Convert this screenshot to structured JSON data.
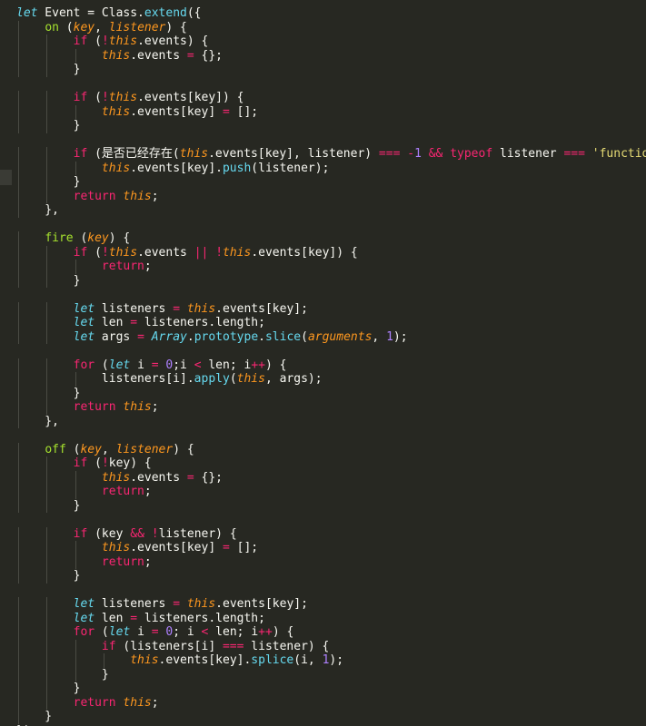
{
  "theme": {
    "background": "#272822",
    "plain": "#f8f8f2",
    "storage": "#66d9ef",
    "keyword": "#f92672",
    "function": "#a6e22e",
    "param": "#fd971f",
    "number": "#ae81ff",
    "string": "#e6db74"
  },
  "code_lines": [
    [
      [
        "storage",
        "let"
      ],
      [
        "plain",
        " Event = Class."
      ],
      [
        "support",
        "extend"
      ],
      [
        "plain",
        "({"
      ]
    ],
    [
      [
        "plain",
        "    "
      ],
      [
        "function",
        "on"
      ],
      [
        "plain",
        " ("
      ],
      [
        "param",
        "key"
      ],
      [
        "plain",
        ", "
      ],
      [
        "param",
        "listener"
      ],
      [
        "plain",
        ") {"
      ]
    ],
    [
      [
        "plain",
        "        "
      ],
      [
        "keyword",
        "if"
      ],
      [
        "plain",
        " ("
      ],
      [
        "operator",
        "!"
      ],
      [
        "this",
        "this"
      ],
      [
        "plain",
        ".events) {"
      ]
    ],
    [
      [
        "plain",
        "            "
      ],
      [
        "this",
        "this"
      ],
      [
        "plain",
        ".events "
      ],
      [
        "operator",
        "="
      ],
      [
        "plain",
        " {};"
      ]
    ],
    [
      [
        "plain",
        "        }"
      ]
    ],
    [],
    [
      [
        "plain",
        "        "
      ],
      [
        "keyword",
        "if"
      ],
      [
        "plain",
        " ("
      ],
      [
        "operator",
        "!"
      ],
      [
        "this",
        "this"
      ],
      [
        "plain",
        ".events[key]) {"
      ]
    ],
    [
      [
        "plain",
        "            "
      ],
      [
        "this",
        "this"
      ],
      [
        "plain",
        ".events[key] "
      ],
      [
        "operator",
        "="
      ],
      [
        "plain",
        " [];"
      ]
    ],
    [
      [
        "plain",
        "        }"
      ]
    ],
    [],
    [
      [
        "plain",
        "        "
      ],
      [
        "keyword",
        "if"
      ],
      [
        "plain",
        " (是否已经存在("
      ],
      [
        "this",
        "this"
      ],
      [
        "plain",
        ".events[key], listener) "
      ],
      [
        "operator",
        "==="
      ],
      [
        "plain",
        " "
      ],
      [
        "operator",
        "-"
      ],
      [
        "number",
        "1"
      ],
      [
        "plain",
        " "
      ],
      [
        "operator",
        "&&"
      ],
      [
        "plain",
        " "
      ],
      [
        "keyword",
        "typeof"
      ],
      [
        "plain",
        " listener "
      ],
      [
        "operator",
        "==="
      ],
      [
        "plain",
        " "
      ],
      [
        "string",
        "'function'"
      ],
      [
        "plain",
        ") "
      ],
      [
        "cursor",
        "{"
      ]
    ],
    [
      [
        "plain",
        "            "
      ],
      [
        "this",
        "this"
      ],
      [
        "plain",
        ".events[key]."
      ],
      [
        "support",
        "push"
      ],
      [
        "plain",
        "(listener);"
      ]
    ],
    [
      [
        "plain",
        "        }"
      ]
    ],
    [
      [
        "plain",
        "        "
      ],
      [
        "keyword",
        "return"
      ],
      [
        "plain",
        " "
      ],
      [
        "this",
        "this"
      ],
      [
        "plain",
        ";"
      ]
    ],
    [
      [
        "plain",
        "    },"
      ]
    ],
    [],
    [
      [
        "plain",
        "    "
      ],
      [
        "function",
        "fire"
      ],
      [
        "plain",
        " ("
      ],
      [
        "param",
        "key"
      ],
      [
        "plain",
        ") {"
      ]
    ],
    [
      [
        "plain",
        "        "
      ],
      [
        "keyword",
        "if"
      ],
      [
        "plain",
        " ("
      ],
      [
        "operator",
        "!"
      ],
      [
        "this",
        "this"
      ],
      [
        "plain",
        ".events "
      ],
      [
        "operator",
        "||"
      ],
      [
        "plain",
        " "
      ],
      [
        "operator",
        "!"
      ],
      [
        "this",
        "this"
      ],
      [
        "plain",
        ".events[key]) {"
      ]
    ],
    [
      [
        "plain",
        "            "
      ],
      [
        "keyword",
        "return"
      ],
      [
        "plain",
        ";"
      ]
    ],
    [
      [
        "plain",
        "        }"
      ]
    ],
    [],
    [
      [
        "plain",
        "        "
      ],
      [
        "storage",
        "let"
      ],
      [
        "plain",
        " listeners "
      ],
      [
        "operator",
        "="
      ],
      [
        "plain",
        " "
      ],
      [
        "this",
        "this"
      ],
      [
        "plain",
        ".events[key];"
      ]
    ],
    [
      [
        "plain",
        "        "
      ],
      [
        "storage",
        "let"
      ],
      [
        "plain",
        " len "
      ],
      [
        "operator",
        "="
      ],
      [
        "plain",
        " listeners.length;"
      ]
    ],
    [
      [
        "plain",
        "        "
      ],
      [
        "storage",
        "let"
      ],
      [
        "plain",
        " args "
      ],
      [
        "operator",
        "="
      ],
      [
        "plain",
        " "
      ],
      [
        "builtin",
        "Array"
      ],
      [
        "plain",
        "."
      ],
      [
        "support",
        "prototype"
      ],
      [
        "plain",
        "."
      ],
      [
        "support",
        "slice"
      ],
      [
        "plain",
        "("
      ],
      [
        "param",
        "arguments"
      ],
      [
        "plain",
        ", "
      ],
      [
        "number",
        "1"
      ],
      [
        "plain",
        ");"
      ]
    ],
    [],
    [
      [
        "plain",
        "        "
      ],
      [
        "keyword",
        "for"
      ],
      [
        "plain",
        " ("
      ],
      [
        "storage",
        "let"
      ],
      [
        "plain",
        " i "
      ],
      [
        "operator",
        "="
      ],
      [
        "plain",
        " "
      ],
      [
        "number",
        "0"
      ],
      [
        "plain",
        ";i "
      ],
      [
        "operator",
        "<"
      ],
      [
        "plain",
        " len; i"
      ],
      [
        "operator",
        "++"
      ],
      [
        "plain",
        ") {"
      ]
    ],
    [
      [
        "plain",
        "            listeners[i]."
      ],
      [
        "support",
        "apply"
      ],
      [
        "plain",
        "("
      ],
      [
        "this",
        "this"
      ],
      [
        "plain",
        ", args);"
      ]
    ],
    [
      [
        "plain",
        "        }"
      ]
    ],
    [
      [
        "plain",
        "        "
      ],
      [
        "keyword",
        "return"
      ],
      [
        "plain",
        " "
      ],
      [
        "this",
        "this"
      ],
      [
        "plain",
        ";"
      ]
    ],
    [
      [
        "plain",
        "    },"
      ]
    ],
    [],
    [
      [
        "plain",
        "    "
      ],
      [
        "function",
        "off"
      ],
      [
        "plain",
        " ("
      ],
      [
        "param",
        "key"
      ],
      [
        "plain",
        ", "
      ],
      [
        "param",
        "listener"
      ],
      [
        "plain",
        ") {"
      ]
    ],
    [
      [
        "plain",
        "        "
      ],
      [
        "keyword",
        "if"
      ],
      [
        "plain",
        " ("
      ],
      [
        "operator",
        "!"
      ],
      [
        "plain",
        "key) {"
      ]
    ],
    [
      [
        "plain",
        "            "
      ],
      [
        "this",
        "this"
      ],
      [
        "plain",
        ".events "
      ],
      [
        "operator",
        "="
      ],
      [
        "plain",
        " {};"
      ]
    ],
    [
      [
        "plain",
        "            "
      ],
      [
        "keyword",
        "return"
      ],
      [
        "plain",
        ";"
      ]
    ],
    [
      [
        "plain",
        "        }"
      ]
    ],
    [],
    [
      [
        "plain",
        "        "
      ],
      [
        "keyword",
        "if"
      ],
      [
        "plain",
        " (key "
      ],
      [
        "operator",
        "&&"
      ],
      [
        "plain",
        " "
      ],
      [
        "operator",
        "!"
      ],
      [
        "plain",
        "listener) {"
      ]
    ],
    [
      [
        "plain",
        "            "
      ],
      [
        "this",
        "this"
      ],
      [
        "plain",
        ".events[key] "
      ],
      [
        "operator",
        "="
      ],
      [
        "plain",
        " [];"
      ]
    ],
    [
      [
        "plain",
        "            "
      ],
      [
        "keyword",
        "return"
      ],
      [
        "plain",
        ";"
      ]
    ],
    [
      [
        "plain",
        "        }"
      ]
    ],
    [],
    [
      [
        "plain",
        "        "
      ],
      [
        "storage",
        "let"
      ],
      [
        "plain",
        " listeners "
      ],
      [
        "operator",
        "="
      ],
      [
        "plain",
        " "
      ],
      [
        "this",
        "this"
      ],
      [
        "plain",
        ".events[key];"
      ]
    ],
    [
      [
        "plain",
        "        "
      ],
      [
        "storage",
        "let"
      ],
      [
        "plain",
        " len "
      ],
      [
        "operator",
        "="
      ],
      [
        "plain",
        " listeners.length;"
      ]
    ],
    [
      [
        "plain",
        "        "
      ],
      [
        "keyword",
        "for"
      ],
      [
        "plain",
        " ("
      ],
      [
        "storage",
        "let"
      ],
      [
        "plain",
        " i "
      ],
      [
        "operator",
        "="
      ],
      [
        "plain",
        " "
      ],
      [
        "number",
        "0"
      ],
      [
        "plain",
        "; i "
      ],
      [
        "operator",
        "<"
      ],
      [
        "plain",
        " len; i"
      ],
      [
        "operator",
        "++"
      ],
      [
        "plain",
        ") {"
      ]
    ],
    [
      [
        "plain",
        "            "
      ],
      [
        "keyword",
        "if"
      ],
      [
        "plain",
        " (listeners[i] "
      ],
      [
        "operator",
        "==="
      ],
      [
        "plain",
        " listener) {"
      ]
    ],
    [
      [
        "plain",
        "                "
      ],
      [
        "this",
        "this"
      ],
      [
        "plain",
        ".events[key]."
      ],
      [
        "support",
        "splice"
      ],
      [
        "plain",
        "(i, "
      ],
      [
        "number",
        "1"
      ],
      [
        "plain",
        ");"
      ]
    ],
    [
      [
        "plain",
        "            }"
      ]
    ],
    [
      [
        "plain",
        "        }"
      ]
    ],
    [
      [
        "plain",
        "        "
      ],
      [
        "keyword",
        "return"
      ],
      [
        "plain",
        " "
      ],
      [
        "this",
        "this"
      ],
      [
        "plain",
        ";"
      ]
    ],
    [
      [
        "plain",
        "    }"
      ]
    ],
    [
      [
        "plain",
        "});"
      ]
    ]
  ]
}
